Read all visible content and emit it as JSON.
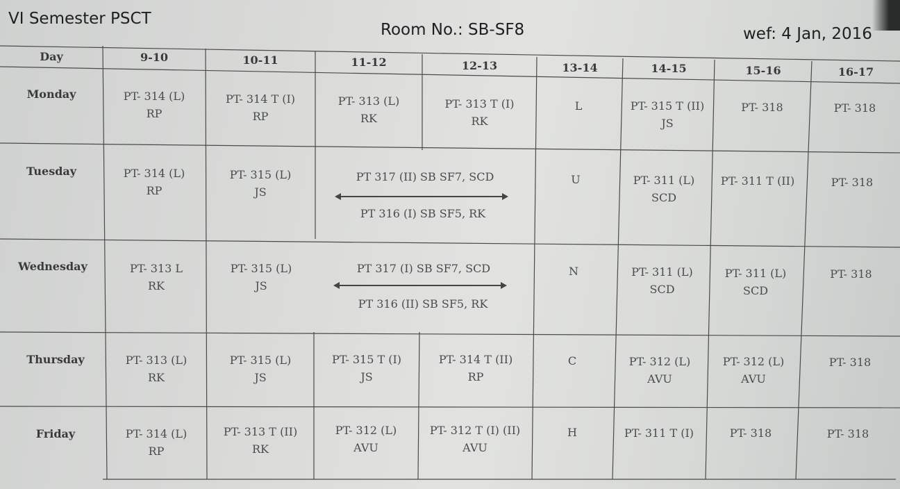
{
  "header": {
    "semester": "VI Semester PSCT",
    "room": "Room No.: SB-SF8",
    "wef": "wef: 4 Jan, 2016"
  },
  "columns": [
    "Day",
    "9-10",
    "10-11",
    "11-12",
    "12-13",
    "13-14",
    "14-15",
    "15-16",
    "16-17"
  ],
  "days": [
    "Monday",
    "Tuesday",
    "Wednesday",
    "Thursday",
    "Friday"
  ],
  "lunch": [
    "L",
    "U",
    "N",
    "C",
    "H"
  ],
  "monday": {
    "c1": [
      "PT- 314 (L)",
      "RP"
    ],
    "c2": [
      "PT- 314  T (I)",
      "RP"
    ],
    "c3": [
      "PT- 313 (L)",
      "RK"
    ],
    "c4": [
      "PT- 313  T (I)",
      "RK"
    ],
    "c6": [
      "PT- 315 T (II)",
      "JS"
    ],
    "c7": [
      "PT- 318"
    ],
    "c8": [
      "PT- 318"
    ]
  },
  "tuesday": {
    "c1": [
      "PT- 314 (L)",
      "RP"
    ],
    "c2": [
      "PT- 315 (L)",
      "JS"
    ],
    "lab_top": "PT 317 (II) SB SF7, SCD",
    "lab_bottom": "PT 316 (I) SB SF5, RK",
    "c6": [
      "PT- 311 (L)",
      "SCD"
    ],
    "c7": [
      "PT- 311 T (II)"
    ],
    "c8": [
      "PT- 318"
    ]
  },
  "wednesday": {
    "c1": [
      "PT- 313  L",
      "RK"
    ],
    "c2": [
      "PT- 315 (L)",
      "JS"
    ],
    "lab_top": "PT 317 (I) SB SF7, SCD",
    "lab_bottom": "PT 316 (II) SB SF5, RK",
    "c6": [
      "PT- 311 (L)",
      "SCD"
    ],
    "c7": [
      "PT- 311 (L)",
      "SCD"
    ],
    "c8": [
      "PT- 318"
    ]
  },
  "thursday": {
    "c1": [
      "PT- 313 (L)",
      "RK"
    ],
    "c2": [
      "PT- 315 (L)",
      "JS"
    ],
    "c3": [
      "PT- 315 T (I)",
      "JS"
    ],
    "c4": [
      "PT- 314  T (II)",
      "RP"
    ],
    "c6": [
      "PT- 312 (L)",
      "AVU"
    ],
    "c7": [
      "PT- 312 (L)",
      "AVU"
    ],
    "c8": [
      "PT- 318"
    ]
  },
  "friday": {
    "c1": [
      "PT- 314 (L)",
      "RP"
    ],
    "c2": [
      "PT- 313  T (II)",
      "RK"
    ],
    "c3": [
      "PT- 312 (L)",
      "AVU"
    ],
    "c4": [
      "PT- 312  T (I) (II)",
      "AVU"
    ],
    "c6": [
      "PT- 311 T (I)"
    ],
    "c7": [
      "PT- 318"
    ],
    "c8": [
      "PT- 318"
    ]
  }
}
